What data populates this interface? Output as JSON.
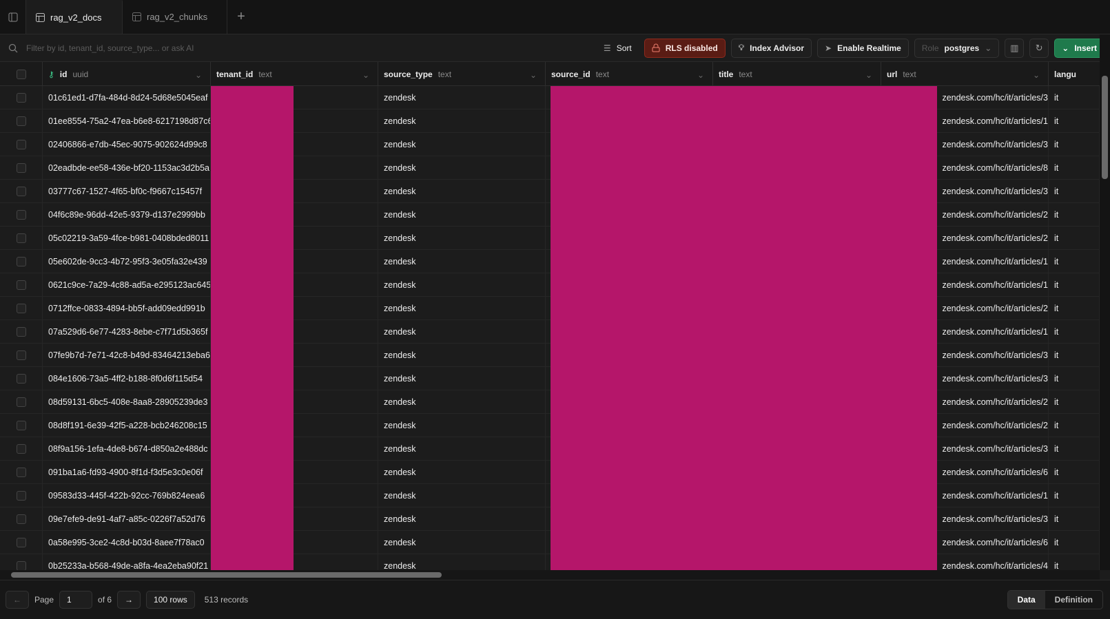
{
  "tabs": [
    {
      "label": "rag_v2_docs",
      "active": true
    },
    {
      "label": "rag_v2_chunks",
      "active": false
    }
  ],
  "toolbar": {
    "filter_placeholder": "Filter by id, tenant_id, source_type... or ask AI",
    "sort_label": "Sort",
    "rls_label": "RLS disabled",
    "index_advisor_label": "Index Advisor",
    "realtime_label": "Enable Realtime",
    "role_label": "Role",
    "role_value": "postgres",
    "insert_label": "Insert"
  },
  "columns": [
    {
      "name": "id",
      "type": "uuid",
      "primary_key": true
    },
    {
      "name": "tenant_id",
      "type": "text"
    },
    {
      "name": "source_type",
      "type": "text"
    },
    {
      "name": "source_id",
      "type": "text"
    },
    {
      "name": "title",
      "type": "text"
    },
    {
      "name": "url",
      "type": "text"
    },
    {
      "name": "langu",
      "type": ""
    }
  ],
  "rows": [
    {
      "id": "01c61ed1-d7fa-484d-8d24-5d68e5045eaf",
      "source_type": "zendesk",
      "url": "zendesk.com/hc/it/articles/3",
      "lang": "it"
    },
    {
      "id": "01ee8554-75a2-47ea-b6e8-6217198d87c6",
      "source_type": "zendesk",
      "url": "zendesk.com/hc/it/articles/1",
      "lang": "it"
    },
    {
      "id": "02406866-e7db-45ec-9075-902624d99c8",
      "source_type": "zendesk",
      "url": "zendesk.com/hc/it/articles/3",
      "lang": "it"
    },
    {
      "id": "02eadbde-ee58-436e-bf20-1153ac3d2b5a",
      "source_type": "zendesk",
      "url": "zendesk.com/hc/it/articles/8",
      "lang": "it"
    },
    {
      "id": "03777c67-1527-4f65-bf0c-f9667c15457f",
      "source_type": "zendesk",
      "url": "zendesk.com/hc/it/articles/3",
      "lang": "it"
    },
    {
      "id": "04f6c89e-96dd-42e5-9379-d137e2999bb",
      "source_type": "zendesk",
      "url": "zendesk.com/hc/it/articles/2",
      "lang": "it"
    },
    {
      "id": "05c02219-3a59-4fce-b981-0408bded8011",
      "source_type": "zendesk",
      "url": "zendesk.com/hc/it/articles/2",
      "lang": "it"
    },
    {
      "id": "05e602de-9cc3-4b72-95f3-3e05fa32e439",
      "source_type": "zendesk",
      "url": "zendesk.com/hc/it/articles/1",
      "lang": "it"
    },
    {
      "id": "0621c9ce-7a29-4c88-ad5a-e295123ac645",
      "source_type": "zendesk",
      "url": "zendesk.com/hc/it/articles/1",
      "lang": "it"
    },
    {
      "id": "0712ffce-0833-4894-bb5f-add09edd991b",
      "source_type": "zendesk",
      "url": "zendesk.com/hc/it/articles/2",
      "lang": "it"
    },
    {
      "id": "07a529d6-6e77-4283-8ebe-c7f71d5b365f",
      "source_type": "zendesk",
      "url": "zendesk.com/hc/it/articles/1",
      "lang": "it"
    },
    {
      "id": "07fe9b7d-7e71-42c8-b49d-83464213eba6",
      "source_type": "zendesk",
      "url": "zendesk.com/hc/it/articles/3",
      "lang": "it"
    },
    {
      "id": "084e1606-73a5-4ff2-b188-8f0d6f115d54",
      "source_type": "zendesk",
      "url": "zendesk.com/hc/it/articles/3",
      "lang": "it"
    },
    {
      "id": "08d59131-6bc5-408e-8aa8-28905239de3",
      "source_type": "zendesk",
      "url": "zendesk.com/hc/it/articles/2",
      "lang": "it"
    },
    {
      "id": "08d8f191-6e39-42f5-a228-bcb246208c15",
      "source_type": "zendesk",
      "url": "zendesk.com/hc/it/articles/2",
      "lang": "it"
    },
    {
      "id": "08f9a156-1efa-4de8-b674-d850a2e488dc",
      "source_type": "zendesk",
      "url": "zendesk.com/hc/it/articles/3",
      "lang": "it"
    },
    {
      "id": "091ba1a6-fd93-4900-8f1d-f3d5e3c0e06f",
      "source_type": "zendesk",
      "url": "zendesk.com/hc/it/articles/6",
      "lang": "it"
    },
    {
      "id": "09583d33-445f-422b-92cc-769b824eea6",
      "source_type": "zendesk",
      "url": "zendesk.com/hc/it/articles/1",
      "lang": "it"
    },
    {
      "id": "09e7efe9-de91-4af7-a85c-0226f7a52d76",
      "source_type": "zendesk",
      "url": "zendesk.com/hc/it/articles/3",
      "lang": "it"
    },
    {
      "id": "0a58e995-3ce2-4c8d-b03d-8aee7f78ac0",
      "source_type": "zendesk",
      "url": "zendesk.com/hc/it/articles/6",
      "lang": "it"
    },
    {
      "id": "0b25233a-b568-49de-a8fa-4ea2eba90f21",
      "source_type": "zendesk",
      "url": "zendesk.com/hc/it/articles/4",
      "lang": "it"
    }
  ],
  "footer": {
    "page_label": "Page",
    "page_value": "1",
    "of_pages": "of 6",
    "rows_label": "100 rows",
    "records_label": "513 records",
    "view_data": "Data",
    "view_definition": "Definition"
  },
  "colors": {
    "redaction": "#b5166a",
    "accent_green": "#1f7a4c",
    "rls_red": "#5a1c14"
  }
}
